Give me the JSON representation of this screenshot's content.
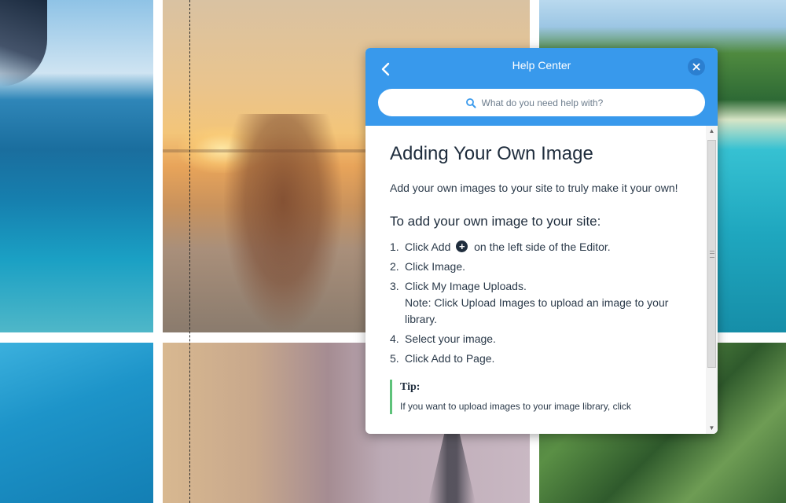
{
  "help_panel": {
    "title": "Help Center",
    "back_icon": "chevron-left-icon",
    "close_icon": "close-icon",
    "search": {
      "placeholder": "What do you need help with?",
      "value": "",
      "icon": "search-icon"
    }
  },
  "article": {
    "title": "Adding Your Own Image",
    "intro": "Add your own images to your site to truly make it your own!",
    "steps_heading": "To add your own image to your site:",
    "steps": [
      {
        "num": "1.",
        "before": "Click Add",
        "icon": "plus-circle-icon",
        "after": "on the left side of the Editor."
      },
      {
        "num": "2.",
        "text": "Click Image."
      },
      {
        "num": "3.",
        "text": "Click My Image Uploads.",
        "note": "Note: Click Upload Images to upload an image to your library."
      },
      {
        "num": "4.",
        "text": "Select your image."
      },
      {
        "num": "5.",
        "text": "Click Add to Page."
      }
    ],
    "tip": {
      "label": "Tip:",
      "text": "If you want to upload images to your image library, click"
    }
  },
  "colors": {
    "header_blue": "#3899ec",
    "close_button": "#2b7fd0",
    "tip_border": "#5ec27a",
    "text_dark": "#1f2d3d"
  },
  "gallery": {
    "images": [
      "aerial-island-photo",
      "couple-beach-sunset-photo",
      "tropical-island-photo",
      "ocean-waves-photo",
      "eiffel-tower-photo",
      "palm-trees-aerial-photo"
    ]
  }
}
